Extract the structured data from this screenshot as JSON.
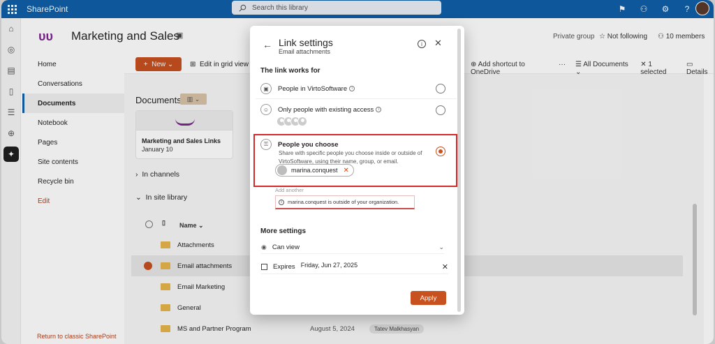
{
  "suitebar": {
    "app_name": "SharePoint",
    "search_placeholder": "Search this library"
  },
  "site": {
    "title": "Marketing and Sales",
    "privacy": "Private group",
    "follow": "Not following",
    "members": "10 members"
  },
  "nav": [
    "Home",
    "Conversations",
    "Documents",
    "Notebook",
    "Pages",
    "Site contents",
    "Recycle bin",
    "Edit"
  ],
  "classic_link": "Return to classic SharePoint",
  "commands": {
    "new": "New",
    "grid": "Edit in grid view",
    "shortcut": "Add shortcut to OneDrive",
    "view": "All Documents",
    "selected": "1 selected",
    "details": "Details"
  },
  "library": {
    "title": "Documents",
    "card_title": "Marketing and Sales Links",
    "card_date": "January 10",
    "channels": "In channels",
    "site_library": "In site library",
    "column_name": "Name",
    "rows": [
      {
        "name": "Attachments",
        "modified": "",
        "by": ""
      },
      {
        "name": "Email attachments",
        "modified": "",
        "by": ""
      },
      {
        "name": "Email Marketing",
        "modified": "",
        "by": ""
      },
      {
        "name": "General",
        "modified": "",
        "by": ""
      },
      {
        "name": "MS and Partner Program",
        "modified": "August 5, 2024",
        "by": "Tatev Malkhasyan"
      }
    ]
  },
  "dialog": {
    "title": "Link settings",
    "subtitle": "Email attachments",
    "works_for": "The link works for",
    "option_org": "People in VirtoSoftware",
    "option_existing": "Only people with existing access",
    "option_choose": "People you choose",
    "choose_desc": "Share with specific people you choose inside or outside of VirtoSoftware, using their name, group, or email.",
    "chip_user": "marina.conquest",
    "add_another": "Add another",
    "warning": "marina.conquest is outside of your organization.",
    "more_settings": "More settings",
    "permission": "Can view",
    "expires_label": "Expires",
    "expires_date": "Friday, Jun 27, 2025",
    "apply": "Apply"
  },
  "colors": {
    "suitebar": "#0f5fa8",
    "accent": "#c7511f",
    "highlight": "#d62828"
  }
}
